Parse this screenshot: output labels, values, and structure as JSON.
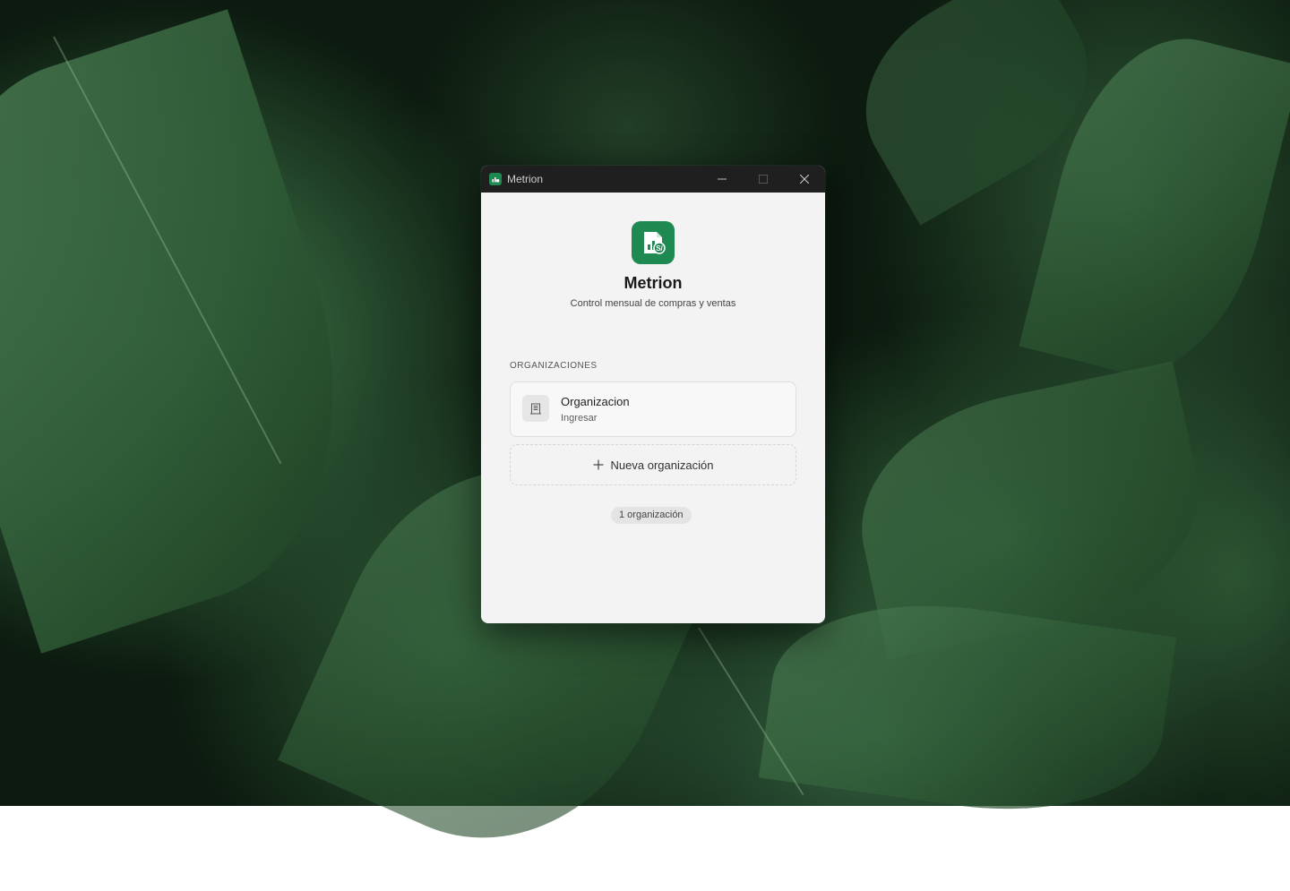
{
  "window": {
    "title": "Metrion",
    "controls": [
      "minimize",
      "maximize",
      "close"
    ]
  },
  "app": {
    "name": "Metrion",
    "subtitle": "Control mensual de compras y ventas",
    "logo_icon": "chart-coin-icon",
    "accent_color": "#1e8a52"
  },
  "organizations": {
    "section_label": "ORGANIZACIONES",
    "items": [
      {
        "name": "Organizacion",
        "action": "Ingresar",
        "icon": "building-icon"
      }
    ],
    "new_label": "Nueva organización",
    "count_label": "1 organización"
  }
}
